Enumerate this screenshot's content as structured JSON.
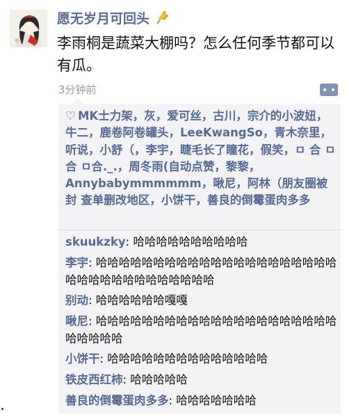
{
  "post": {
    "username": "愿无岁月可回头",
    "text": "李雨桐是蔬菜大棚吗？怎么任何季节都可以有瓜。",
    "time": "3分钟前"
  },
  "icons": {
    "heart": "heart-icon",
    "more": "more-options-icon",
    "wheat": "wheat-emoji-icon"
  },
  "likes": {
    "names": "MK士力架，灰，爱可丝，古川，宗介的小波妞，牛二，鹿卷阿卷罐头，LeeKwangSo，青木奈里，听说，小舒（，李宇，睫毛长了瞳花，假笑，ㅁ 合 ㅁ 合 ㅁ合._.，周冬雨(自动点赞，黎黎，Annybabymmmmmm，啾尼，阿林（朋友圈被封 查单删改地区，小饼干，善良的倒霉蛋肉多多"
  },
  "comments": [
    {
      "name": "skuukzky",
      "text": ": 哈哈哈哈哈哈哈哈哈哈"
    },
    {
      "name": "李宇",
      "text": ": 哈哈哈哈哈哈哈哈哈哈哈哈哈哈哈哈哈哈哈哈哈哈哈哈哈哈哈哈哈哈哈哈哈哈"
    },
    {
      "name": "别动",
      "text": ": 哈哈哈哈哈哈嘎嘎"
    },
    {
      "name": "啾尼",
      "text": ": 哈哈哈哈哈哈哈哈哈哈哈哈哈哈哈哈哈哈哈哈哈哈哈哈哈哈"
    },
    {
      "name": "小饼干",
      "text": ": 哈哈哈哈哈哈哈哈哈哈哈哈哈哈"
    },
    {
      "name": "铁皮西红柿",
      "text": ": 哈哈哈哈哈"
    },
    {
      "name": "善良的倒霉蛋肉多多",
      "text": ": 哈哈哈哈哈哈哈"
    }
  ]
}
